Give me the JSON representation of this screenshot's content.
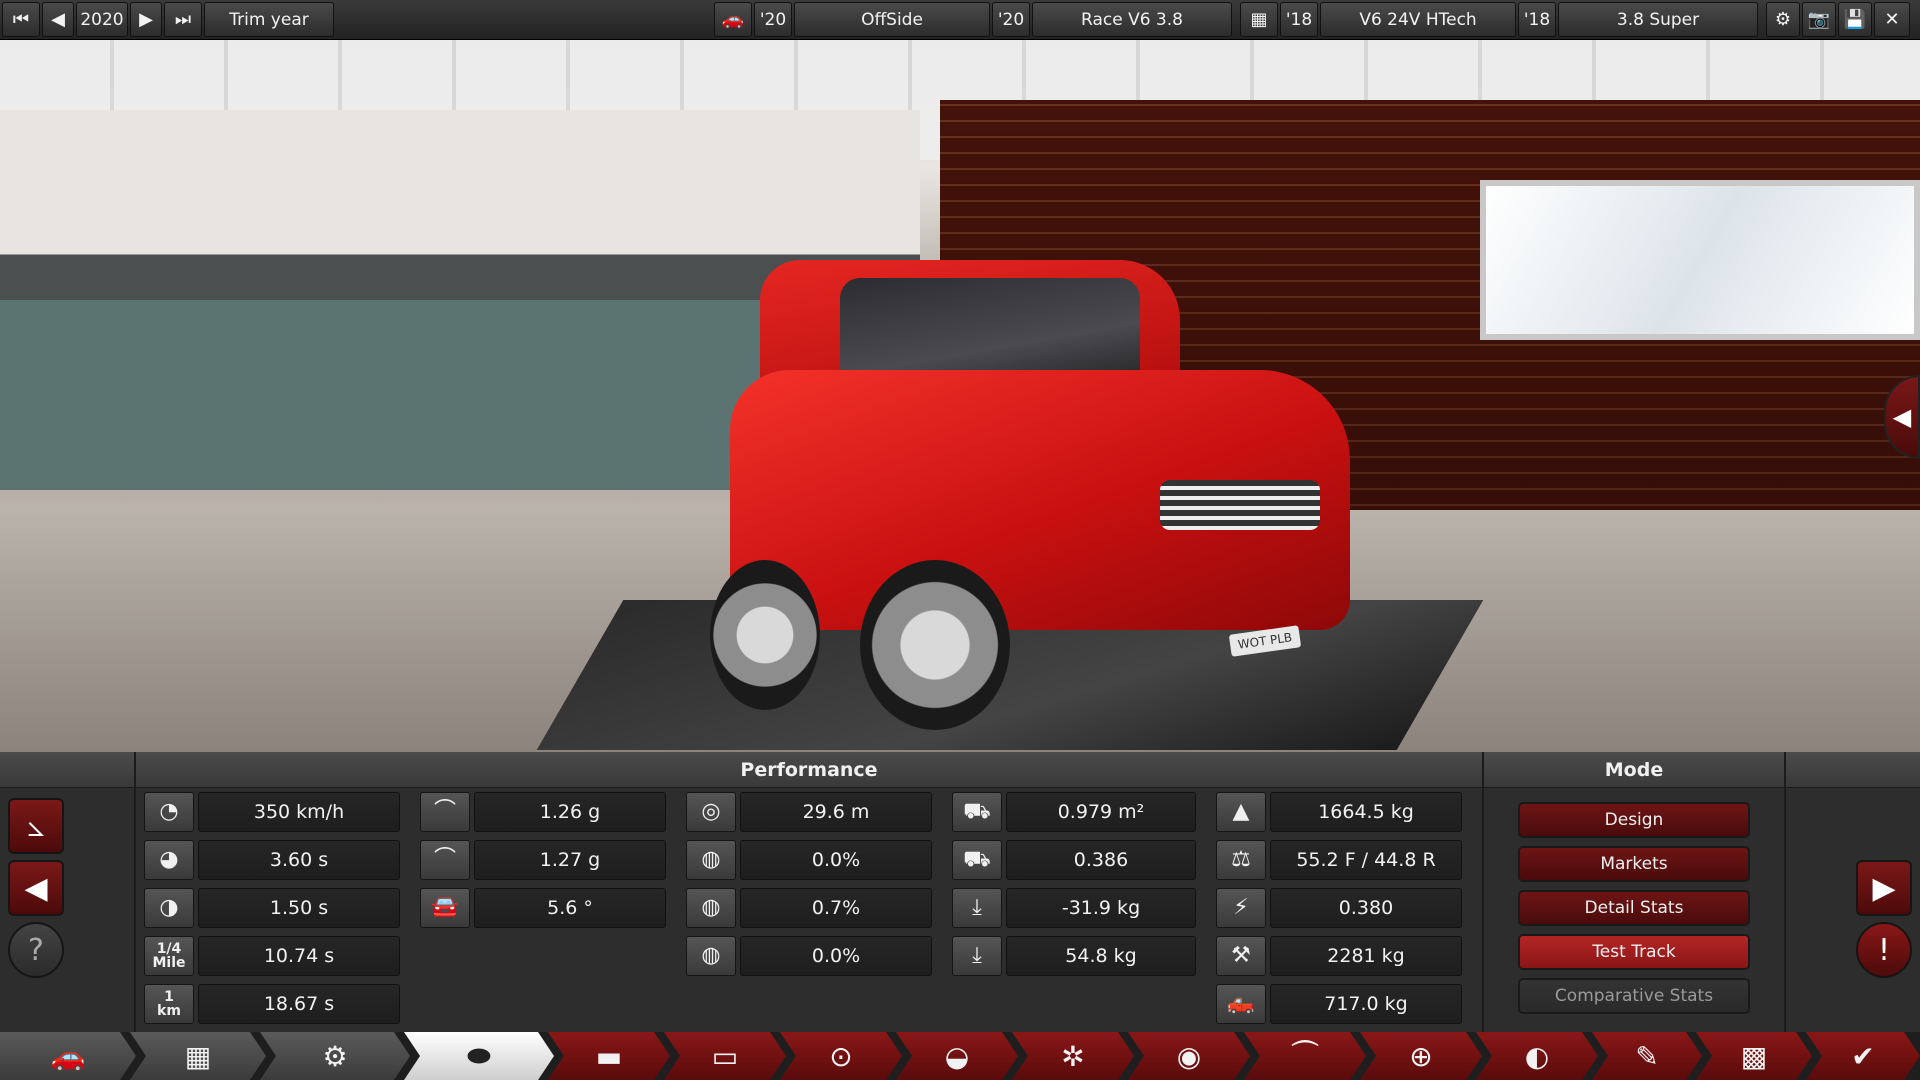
{
  "topbar": {
    "year": "2020",
    "trim_year_label": "Trim year",
    "model_year": "'20",
    "model_name": "OffSide",
    "trim_year": "'20",
    "trim_name": "Race V6 3.8",
    "engine_family_year": "'18",
    "engine_family": "V6 24V HTech",
    "engine_variant_year": "'18",
    "engine_variant": "3.8 Super"
  },
  "scene": {
    "license_plate": "WOT PLB"
  },
  "performance": {
    "title": "Performance",
    "col1": [
      {
        "icon": "top-speed-icon",
        "glyph": "◔",
        "value": "350 km/h"
      },
      {
        "icon": "acceleration-0-100-icon",
        "glyph": "◕",
        "value": "3.60 s"
      },
      {
        "icon": "acceleration-80-120-icon",
        "glyph": "◑",
        "value": "1.50 s"
      },
      {
        "icon": "quarter-mile-icon",
        "glyph_top": "1/4",
        "glyph_bottom": "Mile",
        "value": "10.74 s"
      },
      {
        "icon": "one-km-icon",
        "glyph_top": "1",
        "glyph_bottom": "km",
        "value": "18.67 s"
      }
    ],
    "col2": [
      {
        "icon": "cornering-low-speed-icon",
        "glyph": "⌒",
        "value": "1.26 g"
      },
      {
        "icon": "cornering-high-speed-icon",
        "glyph": "⌒",
        "value": "1.27 g"
      },
      {
        "icon": "body-roll-icon",
        "glyph": "🚘",
        "value": "5.6 °"
      }
    ],
    "col3": [
      {
        "icon": "braking-distance-icon",
        "glyph": "◎",
        "value": "29.6 m"
      },
      {
        "icon": "brake-fade-icon",
        "glyph": "◍",
        "value": "0.0%"
      },
      {
        "icon": "brake-bias-icon",
        "glyph": "◍",
        "value": "0.7%"
      },
      {
        "icon": "brake-lockup-icon",
        "glyph": "◍",
        "value": "0.0%"
      }
    ],
    "col4": [
      {
        "icon": "frontal-area-icon",
        "glyph": "⛟",
        "value": "0.979 m²"
      },
      {
        "icon": "drag-coefficient-icon",
        "glyph": "⛟",
        "value": "0.386"
      },
      {
        "icon": "front-downforce-icon",
        "glyph": "⤓",
        "value": "-31.9 kg"
      },
      {
        "icon": "rear-downforce-icon",
        "glyph": "⤓",
        "value": "54.8 kg"
      }
    ],
    "col5": [
      {
        "icon": "weight-icon",
        "glyph": "▲",
        "value": "1664.5 kg"
      },
      {
        "icon": "weight-distribution-icon",
        "glyph": "⚖",
        "value": "55.2 F / 44.8 R"
      },
      {
        "icon": "center-of-gravity-icon",
        "glyph": "⚡",
        "value": "0.380"
      },
      {
        "icon": "towing-capacity-icon",
        "glyph": "⚒",
        "value": "2281 kg"
      },
      {
        "icon": "cargo-capacity-icon",
        "glyph": "🛻",
        "value": "717.0 kg"
      }
    ]
  },
  "mode": {
    "title": "Mode",
    "buttons": [
      {
        "label": "Design",
        "state": "normal"
      },
      {
        "label": "Markets",
        "state": "normal"
      },
      {
        "label": "Detail Stats",
        "state": "normal"
      },
      {
        "label": "Test Track",
        "state": "active"
      },
      {
        "label": "Comparative Stats",
        "state": "disabled"
      }
    ]
  },
  "nav": [
    {
      "icon": "car-model-icon",
      "glyph": "🚗"
    },
    {
      "icon": "engine-block-icon",
      "glyph": "▦"
    },
    {
      "icon": "engine-tune-icon",
      "glyph": "⚙"
    },
    {
      "icon": "body-icon",
      "glyph": "⬬"
    },
    {
      "icon": "chassis-icon",
      "glyph": "▬"
    },
    {
      "icon": "suspension-icon",
      "glyph": "▭"
    },
    {
      "icon": "drivetrain-icon",
      "glyph": "⊙"
    },
    {
      "icon": "brakes-icon",
      "glyph": "◒"
    },
    {
      "icon": "wheels-icon",
      "glyph": "✲"
    },
    {
      "icon": "tyres-icon",
      "glyph": "◉"
    },
    {
      "icon": "aero-icon",
      "glyph": "⏜"
    },
    {
      "icon": "interior-icon",
      "glyph": "⊕"
    },
    {
      "icon": "safety-icon",
      "glyph": "◐"
    },
    {
      "icon": "paint-icon",
      "glyph": "✎"
    },
    {
      "icon": "testing-icon",
      "glyph": "▩"
    },
    {
      "icon": "finish-icon",
      "glyph": "✔"
    }
  ],
  "colors": {
    "accent_red": "#7b1818",
    "active_red": "#b42525",
    "panel_bg": "#2d2d2d"
  }
}
